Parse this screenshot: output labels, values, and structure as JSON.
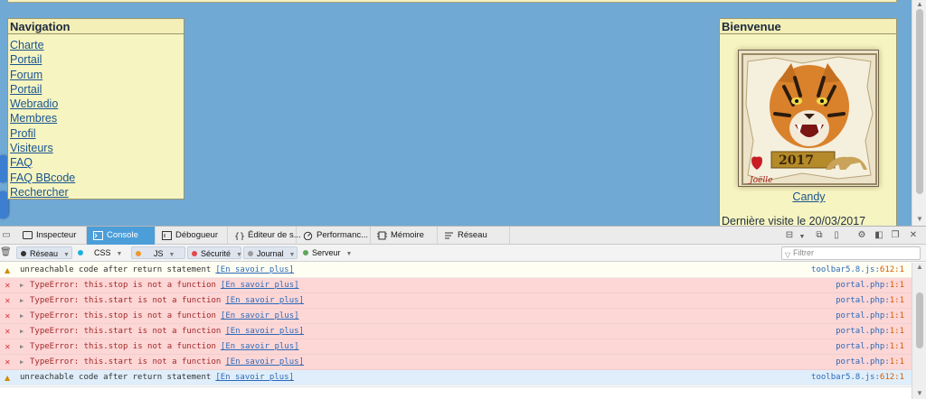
{
  "site": {
    "navigation": {
      "title": "Navigation",
      "links": [
        "Charte",
        "Portail",
        "Forum",
        "Portail",
        "Webradio",
        "Membres",
        "Profil",
        "Visiteurs",
        "FAQ",
        "FAQ BBcode",
        "Rechercher"
      ]
    },
    "welcome": {
      "title": "Bienvenue",
      "avatar_text": "2017",
      "avatar_signature": "Joëlle",
      "username": "Candy",
      "last_visit": "Dernière visite le 20/03/2017"
    }
  },
  "devtools": {
    "tabs": [
      {
        "label": "Inspecteur",
        "icon": "inspector-icon"
      },
      {
        "label": "Console",
        "icon": "console-icon",
        "active": true
      },
      {
        "label": "Débogueur",
        "icon": "debugger-icon"
      },
      {
        "label": "Éditeur de s...",
        "icon": "style-editor-icon"
      },
      {
        "label": "Performanc...",
        "icon": "performance-icon"
      },
      {
        "label": "Mémoire",
        "icon": "memory-icon"
      },
      {
        "label": "Réseau",
        "icon": "network-icon"
      }
    ],
    "filters": [
      {
        "label": "Réseau",
        "color": "#333333",
        "on": true
      },
      {
        "label": "CSS",
        "color": "#1eb0e0",
        "on": false
      },
      {
        "label": "JS",
        "color": "#f0972d",
        "on": true
      },
      {
        "label": "Sécurité",
        "color": "#e34848",
        "on": true
      },
      {
        "label": "Journal",
        "color": "#9b9b9b",
        "on": true
      },
      {
        "label": "Serveur",
        "color": "#5da55d",
        "on": false
      }
    ],
    "filter_placeholder": "Filtrer",
    "messages": [
      {
        "level": "warning",
        "text": "unreachable code after return statement",
        "learn": "[En savoir plus]",
        "file": "toolbar5.8.js",
        "line": "612:1"
      },
      {
        "level": "error",
        "text": "TypeError: this.stop is not a function",
        "learn": "[En savoir plus]",
        "file": "portal.php",
        "line": "1:1"
      },
      {
        "level": "error",
        "text": "TypeError: this.start is not a function",
        "learn": "[En savoir plus]",
        "file": "portal.php",
        "line": "1:1"
      },
      {
        "level": "error",
        "text": "TypeError: this.stop is not a function",
        "learn": "[En savoir plus]",
        "file": "portal.php",
        "line": "1:1"
      },
      {
        "level": "error",
        "text": "TypeError: this.start is not a function",
        "learn": "[En savoir plus]",
        "file": "portal.php",
        "line": "1:1"
      },
      {
        "level": "error",
        "text": "TypeError: this.stop is not a function",
        "learn": "[En savoir plus]",
        "file": "portal.php",
        "line": "1:1"
      },
      {
        "level": "error",
        "text": "TypeError: this.start is not a function",
        "learn": "[En savoir plus]",
        "file": "portal.php",
        "line": "1:1"
      },
      {
        "level": "warning",
        "text": "unreachable code after return statement",
        "learn": "[En savoir plus]",
        "file": "toolbar5.8.js",
        "line": "612:1",
        "selected": true
      }
    ]
  }
}
